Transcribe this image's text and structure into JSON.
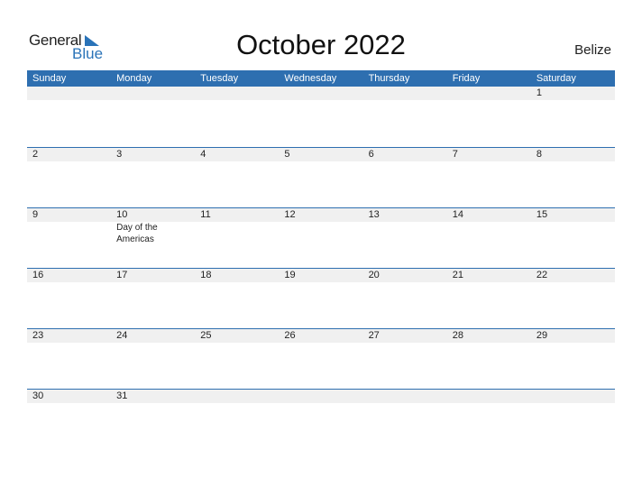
{
  "logo": {
    "general": "General",
    "blue": "Blue"
  },
  "title": "October 2022",
  "country": "Belize",
  "colors": {
    "header_bg": "#2e6fb0",
    "band_bg": "#f0f0f0",
    "logo_blue": "#2a73b8"
  },
  "weekdays": [
    "Sunday",
    "Monday",
    "Tuesday",
    "Wednesday",
    "Thursday",
    "Friday",
    "Saturday"
  ],
  "weeks": [
    [
      {
        "d": ""
      },
      {
        "d": ""
      },
      {
        "d": ""
      },
      {
        "d": ""
      },
      {
        "d": ""
      },
      {
        "d": ""
      },
      {
        "d": "1"
      }
    ],
    [
      {
        "d": "2"
      },
      {
        "d": "3"
      },
      {
        "d": "4"
      },
      {
        "d": "5"
      },
      {
        "d": "6"
      },
      {
        "d": "7"
      },
      {
        "d": "8"
      }
    ],
    [
      {
        "d": "9"
      },
      {
        "d": "10",
        "event": "Day of the Americas"
      },
      {
        "d": "11"
      },
      {
        "d": "12"
      },
      {
        "d": "13"
      },
      {
        "d": "14"
      },
      {
        "d": "15"
      }
    ],
    [
      {
        "d": "16"
      },
      {
        "d": "17"
      },
      {
        "d": "18"
      },
      {
        "d": "19"
      },
      {
        "d": "20"
      },
      {
        "d": "21"
      },
      {
        "d": "22"
      }
    ],
    [
      {
        "d": "23"
      },
      {
        "d": "24"
      },
      {
        "d": "25"
      },
      {
        "d": "26"
      },
      {
        "d": "27"
      },
      {
        "d": "28"
      },
      {
        "d": "29"
      }
    ],
    [
      {
        "d": "30"
      },
      {
        "d": "31"
      },
      {
        "d": ""
      },
      {
        "d": ""
      },
      {
        "d": ""
      },
      {
        "d": ""
      },
      {
        "d": ""
      }
    ]
  ]
}
